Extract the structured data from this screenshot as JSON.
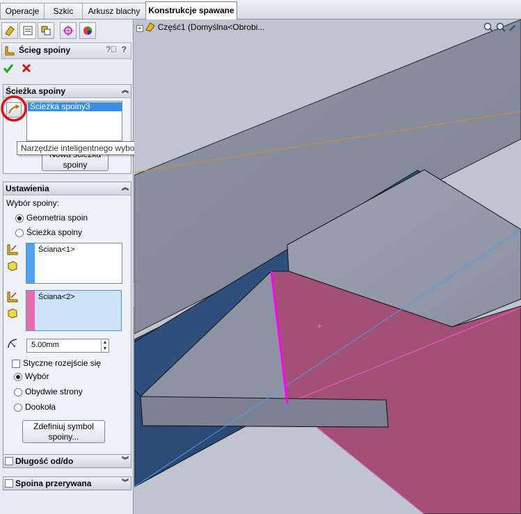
{
  "tabs": [
    {
      "label": "Operacje"
    },
    {
      "label": "Szkic"
    },
    {
      "label": "Arkusz blachy"
    },
    {
      "label": "Konstrukcje spawane"
    }
  ],
  "feature": {
    "title": "Ścieg spoiny",
    "help": "?"
  },
  "sections": {
    "path": {
      "title": "Ścieżka spoiny",
      "selected_item": "Ścieżka spoiny3",
      "new_button": "Nowa ścieżka spoiny",
      "tooltip": "Narzędzie inteligentnego wyboru spoiny"
    },
    "settings": {
      "title": "Ustawienia",
      "weld_selection_label": "Wybór spoiny:",
      "options": [
        "Geometria spoin",
        "Ścieżka spoiny"
      ],
      "selected_option": "Geometria spoin",
      "face1": "Ściana<1>",
      "face2": "Ściana<2>",
      "size_value": "5.00mm",
      "tangent_label": "Styczne rozejście się",
      "side_options": [
        "Wybór",
        "Obydwie strony",
        "Dookoła"
      ],
      "selected_side": "Wybór",
      "symbol_button": "Zdefiniuj symbol spoiny..."
    },
    "length": {
      "title": "Długość od/do"
    },
    "intermittent": {
      "title": "Spoina przerywana"
    }
  },
  "tree": {
    "root_label": "Część1  (Domyślna<Obrobi..."
  },
  "colors": {
    "face1": "#4da3f2",
    "face2": "#e86bb0",
    "weld_line": "#ff00ff",
    "edge_orange": "#d08a3a",
    "edge_blue": "#4f9ee8",
    "selection_circle": "#e01010"
  }
}
